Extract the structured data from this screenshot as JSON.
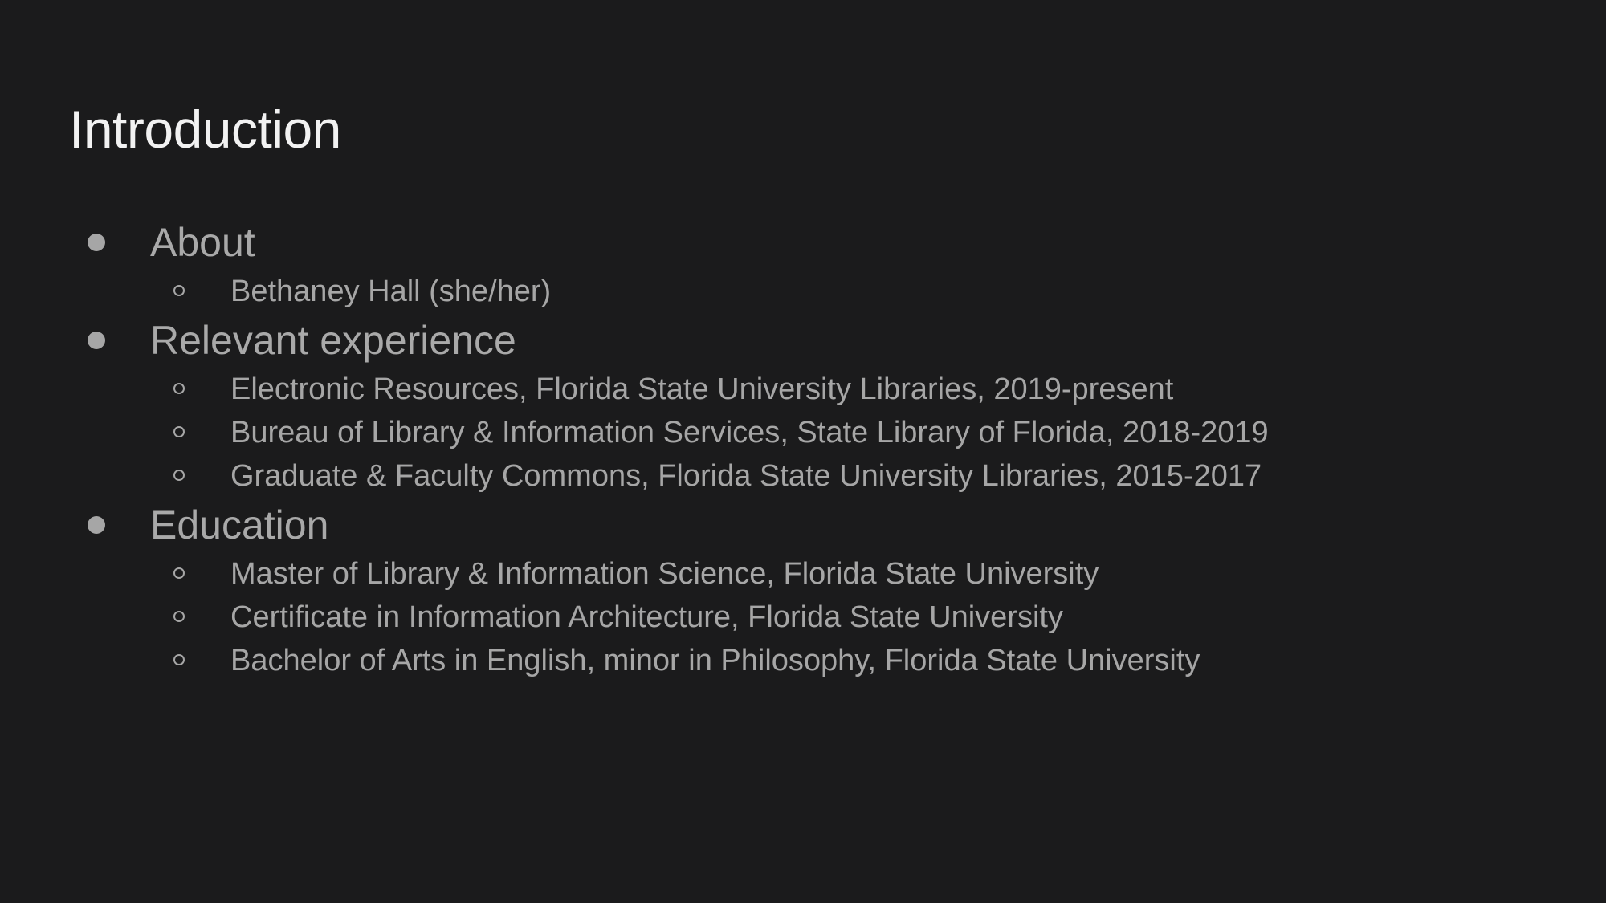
{
  "slide": {
    "title": "Introduction",
    "sections": [
      {
        "label": "About",
        "items": [
          "Bethaney Hall (she/her)"
        ]
      },
      {
        "label": "Relevant experience",
        "items": [
          "Electronic Resources, Florida State University Libraries, 2019-present",
          "Bureau of Library & Information Services, State Library of Florida, 2018-2019",
          "Graduate & Faculty Commons, Florida State University Libraries, 2015-2017"
        ]
      },
      {
        "label": "Education",
        "items": [
          "Master of Library & Information Science, Florida State University",
          "Certificate in Information Architecture, Florida State University",
          "Bachelor of Arts in English, minor in Philosophy, Florida State University"
        ]
      }
    ]
  },
  "colors": {
    "background": "#1b1b1c",
    "title": "#f2f2f2",
    "body_text": "#a6a6a6"
  }
}
